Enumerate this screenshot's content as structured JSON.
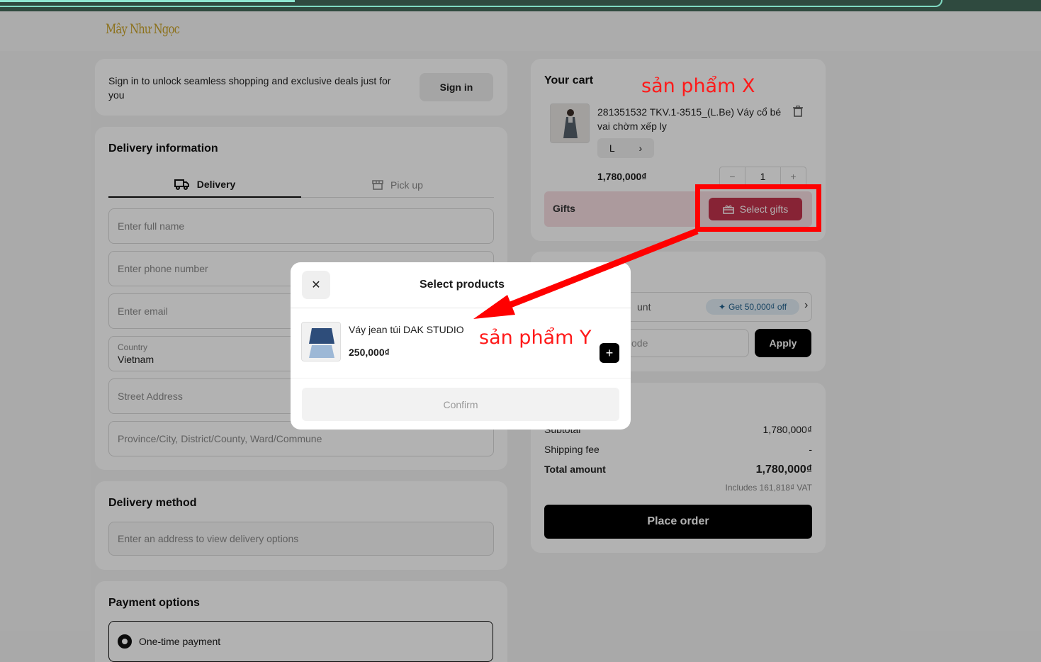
{
  "brand": {
    "logo_text": "Mây Như Ngọc"
  },
  "signin": {
    "message": "Sign in to unlock seamless shopping and exclusive deals just for you",
    "button": "Sign in"
  },
  "delivery": {
    "title": "Delivery information",
    "tabs": [
      {
        "label": "Delivery",
        "active": true
      },
      {
        "label": "Pick up",
        "active": false
      }
    ],
    "fields": {
      "full_name": "Enter full name",
      "phone": "Enter phone number",
      "email": "Enter email",
      "country_label": "Country",
      "country_value": "Vietnam",
      "street": "Street Address",
      "province": "Province/City, District/County, Ward/Commune"
    }
  },
  "delivery_method": {
    "title": "Delivery method",
    "placeholder": "Enter an address to view delivery options"
  },
  "payment": {
    "title": "Payment options",
    "option": "One-time payment"
  },
  "cart": {
    "title": "Your cart",
    "item": {
      "name": "281351532 TKV.1-3515_(L.Be) Váy cổ bé vai chờm xếp ly",
      "size": "L",
      "price": "1,780,000₫",
      "quantity": "1"
    },
    "gifts_label": "Gifts",
    "select_gifts": "Select gifts"
  },
  "discount": {
    "row_text": "unt",
    "badge": "Get 50,000₫ off",
    "code_text": "ode",
    "apply": "Apply"
  },
  "summary": {
    "subtotal_label": "Subtotal",
    "subtotal_value": "1,780,000₫",
    "shipping_label": "Shipping fee",
    "shipping_value": "-",
    "total_label": "Total amount",
    "total_value": "1,780,000₫",
    "vat": "Includes 161,818₫ VAT",
    "place_order": "Place order"
  },
  "modal": {
    "title": "Select products",
    "product_name": "Váy jean túi DAK STUDIO",
    "product_price": "250,000₫",
    "confirm": "Confirm"
  },
  "annotations": {
    "product_x": "sản phẩm X",
    "product_y": "sản phẩm Y",
    "color": "#ff0000"
  },
  "colors": {
    "gift_button": "#c2334d",
    "gift_row": "#f6dde1",
    "logo": "#c9a227"
  }
}
